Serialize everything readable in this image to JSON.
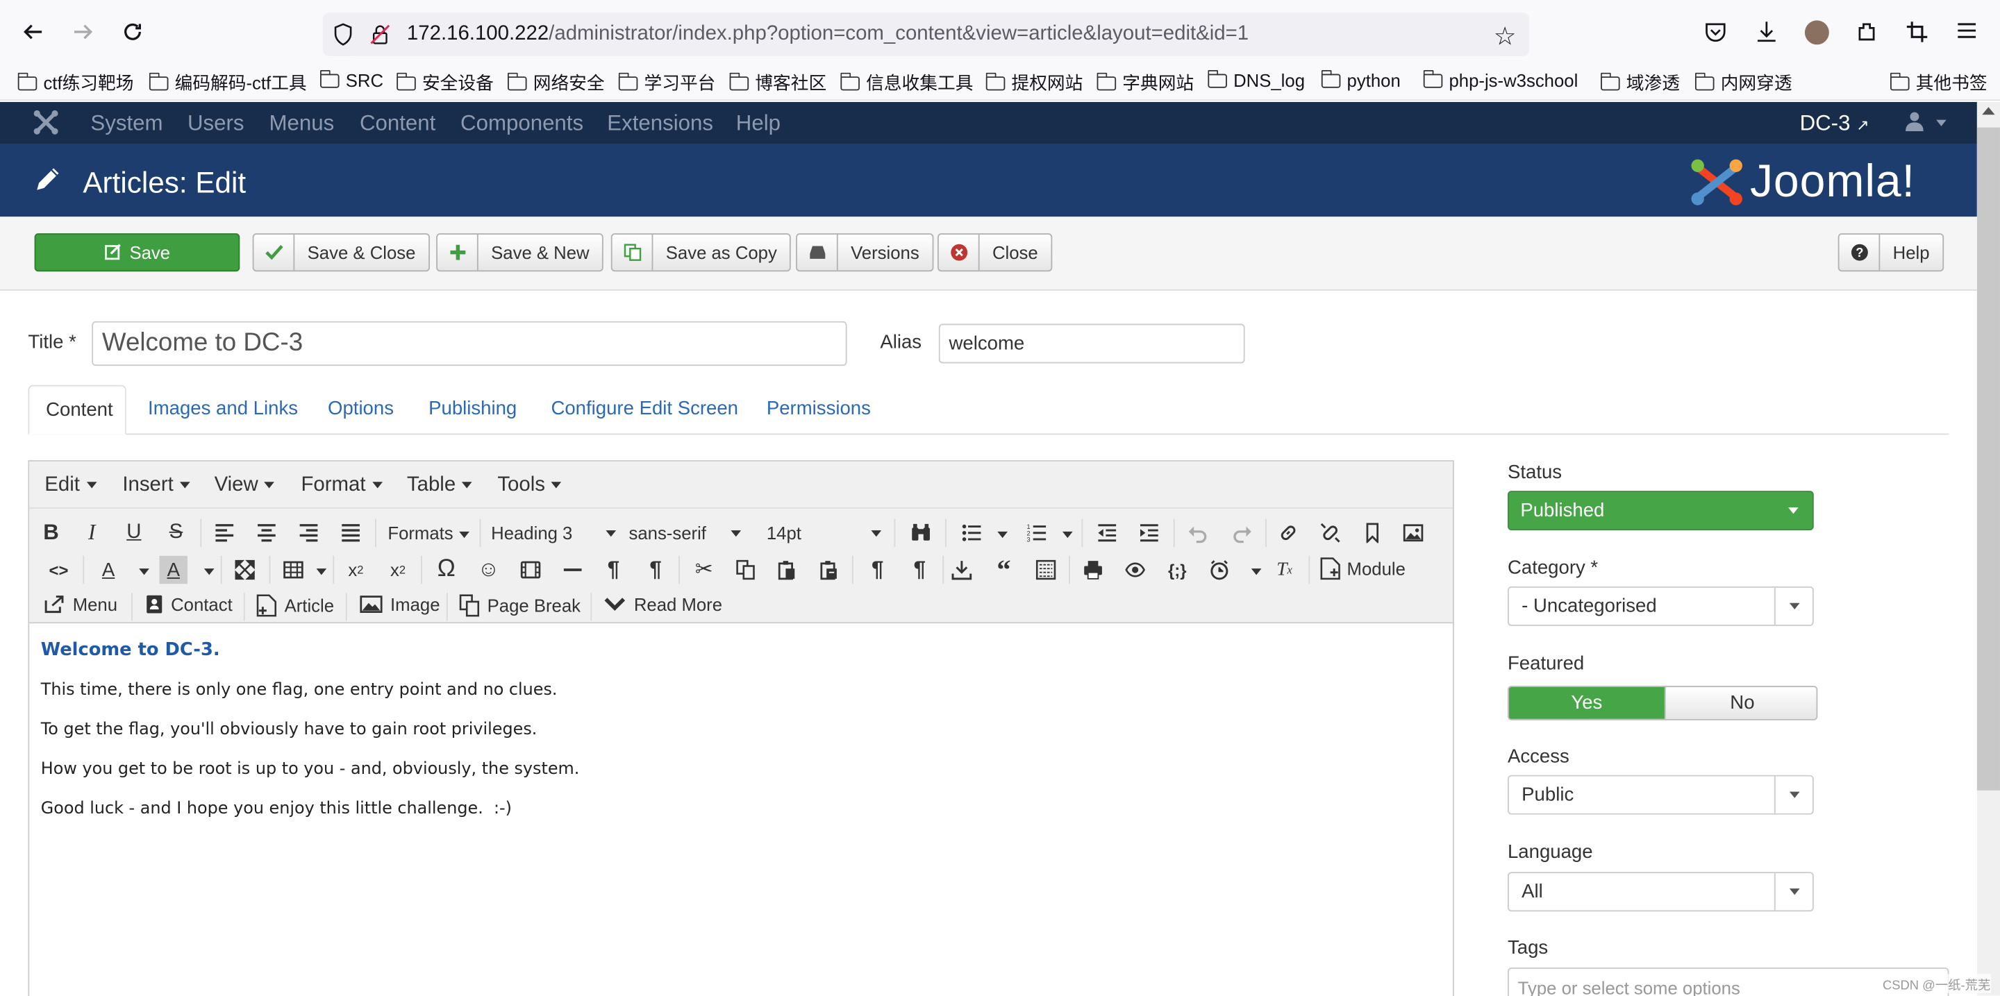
{
  "browser": {
    "url_host": "172.16.100.222",
    "url_path": "/administrator/index.php?option=com_content&view=article&layout=edit&id=1",
    "bookmarks": [
      "ctf练习靶场",
      "编码解码-ctf工具",
      "SRC",
      "安全设备",
      "网络安全",
      "学习平台",
      "博客社区",
      "信息收集工具",
      "提权网站",
      "字典网站",
      "DNS_log",
      "python",
      "php-js-w3school",
      "域渗透",
      "内网穿透"
    ],
    "other_bookmarks": "其他书签"
  },
  "topnav": {
    "items": [
      "System",
      "Users",
      "Menus",
      "Content",
      "Components",
      "Extensions",
      "Help"
    ],
    "site_name": "DC-3"
  },
  "header": {
    "title": "Articles: Edit",
    "brand": "Joomla!"
  },
  "toolbar": {
    "save": "Save",
    "save_close": "Save & Close",
    "save_new": "Save & New",
    "save_copy": "Save as Copy",
    "versions": "Versions",
    "close": "Close",
    "help": "Help"
  },
  "form": {
    "title_label": "Title *",
    "title_value": "Welcome to DC-3",
    "alias_label": "Alias",
    "alias_value": "welcome"
  },
  "tabs": [
    "Content",
    "Images and Links",
    "Options",
    "Publishing",
    "Configure Edit Screen",
    "Permissions"
  ],
  "editor": {
    "menubar": [
      "Edit",
      "Insert",
      "View",
      "Format",
      "Table",
      "Tools"
    ],
    "formats_label": "Formats",
    "block_format": "Heading 3",
    "font_family": "sans-serif",
    "font_size": "14pt",
    "module_label": "Module",
    "buttons": [
      "Menu",
      "Contact",
      "Article",
      "Image",
      "Page Break",
      "Read More"
    ],
    "heading": "Welcome to DC-3.",
    "paragraphs": [
      "This time, there is only one flag, one entry point and no clues.",
      "To get the flag, you'll obviously have to gain root privileges.",
      "How you get to be root is up to you - and, obviously, the system.",
      "Good luck - and I hope you enjoy this little challenge.  :-)"
    ]
  },
  "sidebar": {
    "status_label": "Status",
    "status_value": "Published",
    "category_label": "Category *",
    "category_value": "- Uncategorised",
    "featured_label": "Featured",
    "featured_yes": "Yes",
    "featured_no": "No",
    "access_label": "Access",
    "access_value": "Public",
    "language_label": "Language",
    "language_value": "All",
    "tags_label": "Tags",
    "tags_placeholder": "Type or select some options"
  },
  "watermark": "CSDN @一纸-荒芜",
  "colors": {
    "nav": "#182c4b",
    "header": "#1c3d6e",
    "save_green": "#3f9e3f",
    "link": "#2a69b8"
  }
}
